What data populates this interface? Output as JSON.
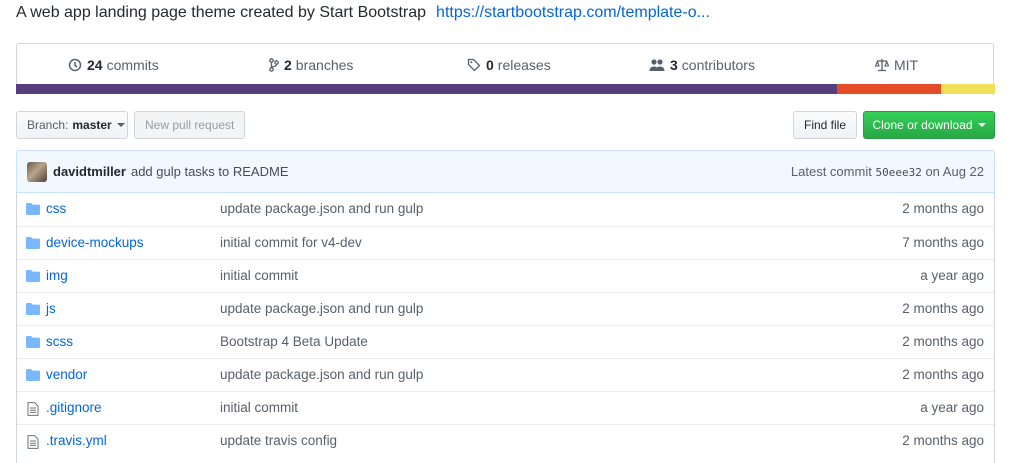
{
  "repo": {
    "description": "A web app landing page theme created by Start Bootstrap",
    "homepage": "https://startbootstrap.com/template-o..."
  },
  "summary": {
    "commits": {
      "count": "24",
      "label": "commits",
      "icon": "history-icon"
    },
    "branches": {
      "count": "2",
      "label": "branches",
      "icon": "branch-icon"
    },
    "releases": {
      "count": "0",
      "label": "releases",
      "icon": "tag-icon"
    },
    "contributors": {
      "count": "3",
      "label": "contributors",
      "icon": "people-icon"
    },
    "license": {
      "label": "MIT",
      "icon": "law-icon"
    }
  },
  "languages": [
    {
      "color": "#563d7c",
      "share": 0.84
    },
    {
      "color": "#e34c26",
      "share": 0.105
    },
    {
      "color": "#f1e05a",
      "share": 0.055
    }
  ],
  "toolbar": {
    "branch_prefix": "Branch:",
    "branch_name": "master",
    "new_pr": "New pull request",
    "find_file": "Find file",
    "clone": "Clone or download"
  },
  "latest_commit": {
    "author": "davidtmiller",
    "message": "add gulp tasks to README",
    "prefix": "Latest commit",
    "sha": "50eee32",
    "date": "on Aug 22"
  },
  "files": [
    {
      "name": "css",
      "type": "dir",
      "message": "update package.json and run gulp",
      "age": "2 months ago"
    },
    {
      "name": "device-mockups",
      "type": "dir",
      "message": "initial commit for v4-dev",
      "age": "7 months ago"
    },
    {
      "name": "img",
      "type": "dir",
      "message": "initial commit",
      "age": "a year ago"
    },
    {
      "name": "js",
      "type": "dir",
      "message": "update package.json and run gulp",
      "age": "2 months ago"
    },
    {
      "name": "scss",
      "type": "dir",
      "message": "Bootstrap 4 Beta Update",
      "age": "2 months ago"
    },
    {
      "name": "vendor",
      "type": "dir",
      "message": "update package.json and run gulp",
      "age": "2 months ago"
    },
    {
      "name": ".gitignore",
      "type": "file",
      "message": "initial commit",
      "age": "a year ago"
    },
    {
      "name": ".travis.yml",
      "type": "file",
      "message": "update travis config",
      "age": "2 months ago"
    }
  ]
}
